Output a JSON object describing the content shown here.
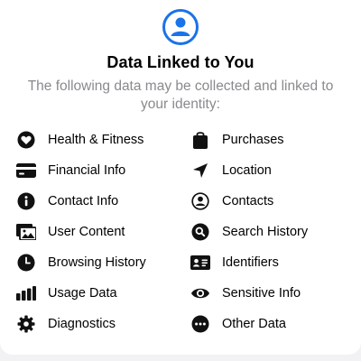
{
  "header": {
    "icon": "person-circle-icon",
    "accent": "#1a73e8",
    "title": "Data Linked to You",
    "subtitle": "The following data may be collected and linked to your identity:"
  },
  "left_items": [
    {
      "label": "Health & Fitness",
      "icon": "heart-icon"
    },
    {
      "label": "Financial Info",
      "icon": "credit-card-icon"
    },
    {
      "label": "Contact Info",
      "icon": "info-icon"
    },
    {
      "label": "User Content",
      "icon": "photos-icon"
    },
    {
      "label": "Browsing History",
      "icon": "clock-icon"
    },
    {
      "label": "Usage Data",
      "icon": "bar-chart-icon"
    },
    {
      "label": "Diagnostics",
      "icon": "gear-icon"
    }
  ],
  "right_items": [
    {
      "label": "Purchases",
      "icon": "shopping-bag-icon"
    },
    {
      "label": "Location",
      "icon": "location-arrow-icon"
    },
    {
      "label": "Contacts",
      "icon": "person-circle-outline-icon"
    },
    {
      "label": "Search History",
      "icon": "magnifier-icon"
    },
    {
      "label": "Identifiers",
      "icon": "id-card-icon"
    },
    {
      "label": "Sensitive Info",
      "icon": "eye-icon"
    },
    {
      "label": "Other Data",
      "icon": "ellipsis-circle-icon"
    }
  ]
}
